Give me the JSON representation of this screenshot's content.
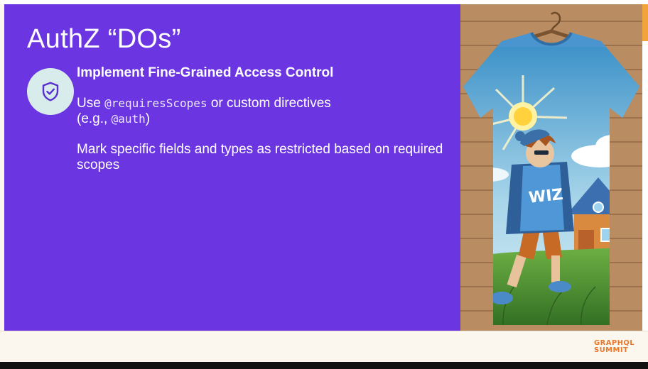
{
  "slide": {
    "title": "AuthZ “DOs”",
    "heading": "Implement Fine-Grained Access Control",
    "para1": {
      "use": "Use ",
      "code1": "@requiresScopes",
      "mid": " or custom directives",
      "eg": "(e.g., ",
      "code2": "@auth",
      "close": ")"
    },
    "para2": "Mark specific fields and types as restricted based on required scopes"
  },
  "image": {
    "shirt_text": "WIZ"
  },
  "footer": {
    "logo_line1": "GRAPHQL",
    "logo_line2": "SUMMIT"
  },
  "colors": {
    "slide_bg": "#6b35e2",
    "icon_bg": "#d8ecec",
    "icon_fg": "#5a2fd0",
    "logo": "#e8792c",
    "footer_bg": "#fbf6ee"
  },
  "icons": {
    "shield": "shield-check-icon"
  }
}
